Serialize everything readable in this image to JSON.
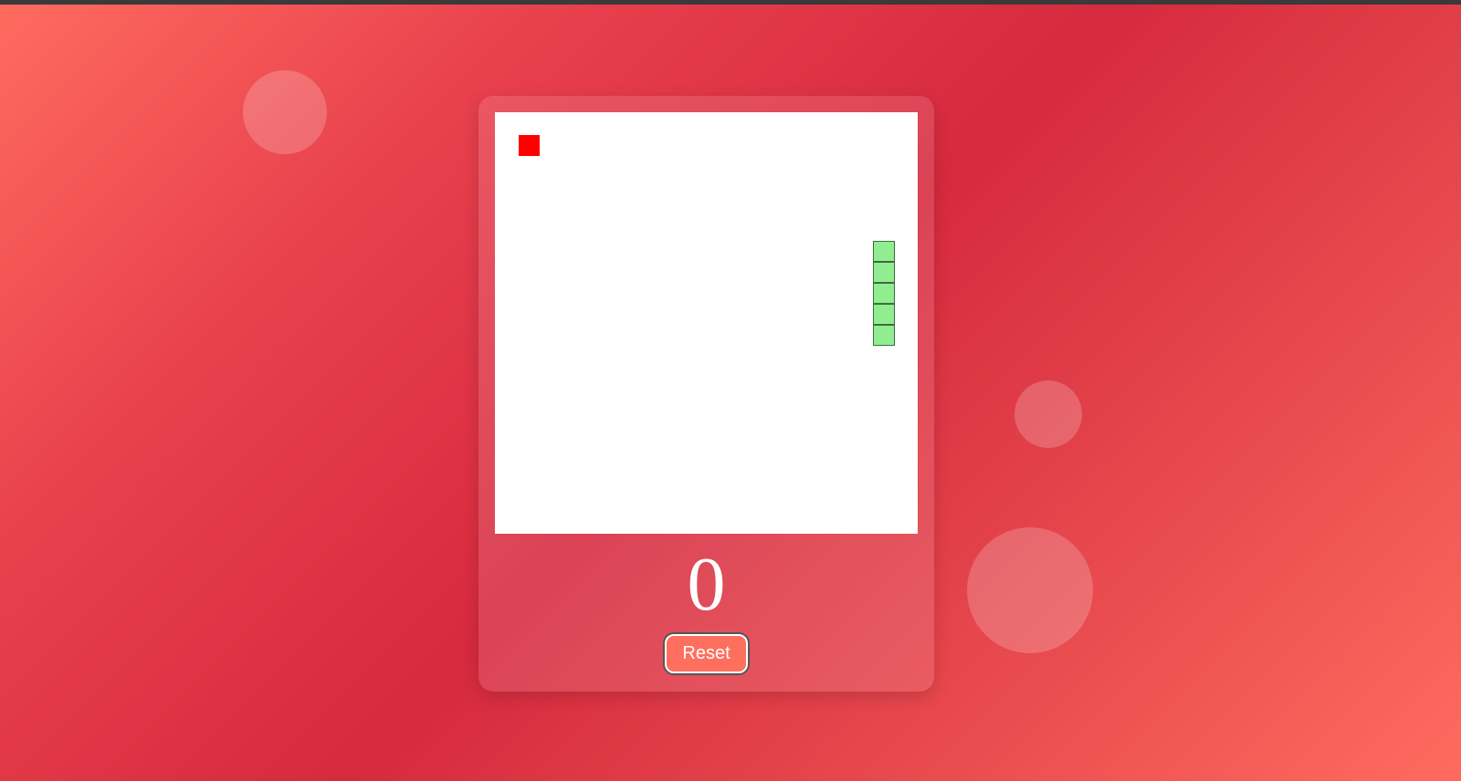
{
  "game": {
    "score": "0",
    "reset_label": "Reset"
  },
  "board": {
    "food_color": "#ff0000",
    "snake_color": "#90ee90",
    "snake_border_color": "#3f6b3f",
    "background_color": "#ffffff"
  },
  "theme": {
    "accent": "#ff6f5e",
    "gradient": [
      "#ff6b5f",
      "#d62a3e"
    ]
  }
}
